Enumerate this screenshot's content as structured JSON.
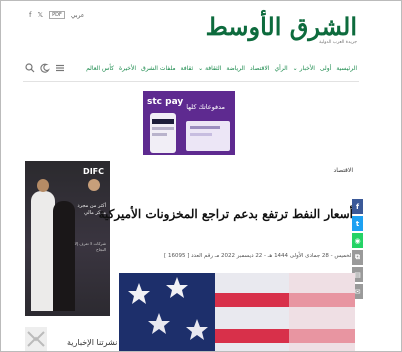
{
  "header": {
    "util_facebook_icon": "f",
    "util_twitter_icon": "𝕏",
    "util_pdf_label": "PDF",
    "util_language": "عربي",
    "logo_text": "الشرق الأوسط",
    "logo_tagline": "جريدة العرب الدولية"
  },
  "nav": {
    "items": [
      "الرئيسية",
      "أولى",
      "الأخبار ⌄",
      "الرأي",
      "الاقتصاد",
      "الرياضة",
      "الثقافة ⌄",
      "ثقافة",
      "ملفات الشرق",
      "الأخيرة",
      "كأس العالم"
    ]
  },
  "ad_banner": {
    "brand": "stc pay",
    "text": "مدفوعاتك كلها"
  },
  "side_ad": {
    "brand": "DIFC",
    "text": "أكثر من مجرد مركز مالي",
    "subtext": "شركات لا تعرف إلا النجاح"
  },
  "article": {
    "section": "الاقتصاد",
    "headline": "أسعار النفط ترتفع بدعم تراجع المخزونات الأميركية",
    "meta": "الخميس - 28 جمادى الأولى 1444 هـ - 22 ديسمبر 2022 مـ رقم العدد [ 16095 ]"
  },
  "newsletter": {
    "title": "نشرتنا الإخبارية"
  },
  "colors": {
    "brand_green": "#0d6b3d",
    "facebook": "#3b5998",
    "twitter": "#1da1f2",
    "whatsapp": "#25d366",
    "share_gray": "#9a9a9a"
  },
  "icons": {
    "search": "search-icon",
    "dark_mode": "moon-icon",
    "menu": "hamburger-icon"
  }
}
